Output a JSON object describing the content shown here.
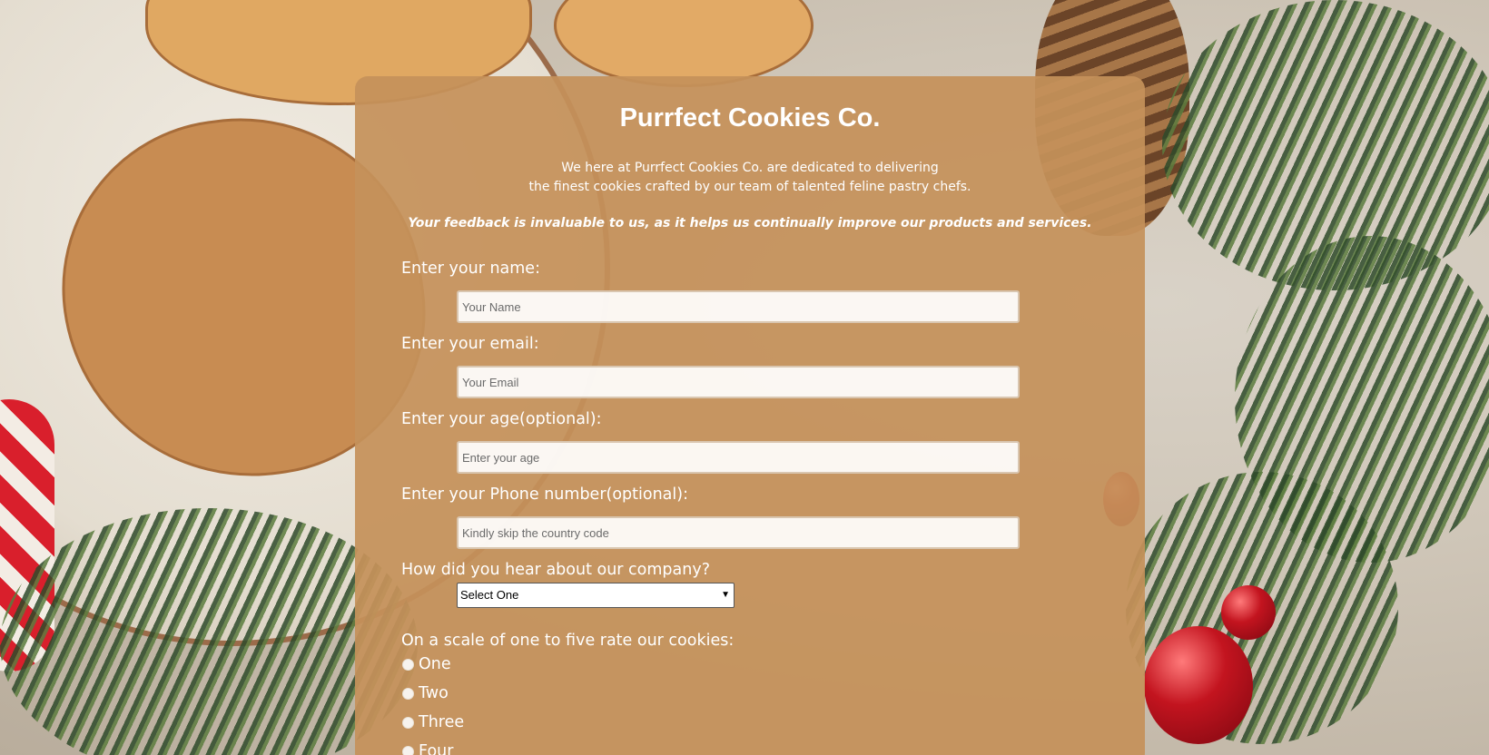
{
  "company": {
    "title": "Purrfect Cookies Co.",
    "intro_line1": "We here at Purrfect Cookies Co. are dedicated to delivering",
    "intro_line2": "the finest cookies crafted by our team of talented feline pastry chefs.",
    "feedback_note": "Your feedback is invaluable to us, as it helps us continually improve our products and services."
  },
  "form": {
    "name": {
      "label": "Enter your name:",
      "placeholder": "Your Name",
      "value": ""
    },
    "email": {
      "label": "Enter your email:",
      "placeholder": "Your Email",
      "value": ""
    },
    "age": {
      "label": "Enter your age(optional):",
      "placeholder": "Enter your age",
      "value": ""
    },
    "phone": {
      "label": "Enter your Phone number(optional):",
      "placeholder": "Kindly skip the country code",
      "value": ""
    },
    "referral": {
      "label": "How did you hear about our company?",
      "selected": "Select One"
    },
    "rating": {
      "label": "On a scale of one to five rate our cookies:",
      "options": [
        "One",
        "Two",
        "Three",
        "Four"
      ]
    }
  },
  "icons": {
    "select_arrow": "chevron-down-icon",
    "radio": "radio-button-icon"
  },
  "colors": {
    "card_background": "#c5915a",
    "text": "#ffffff"
  }
}
